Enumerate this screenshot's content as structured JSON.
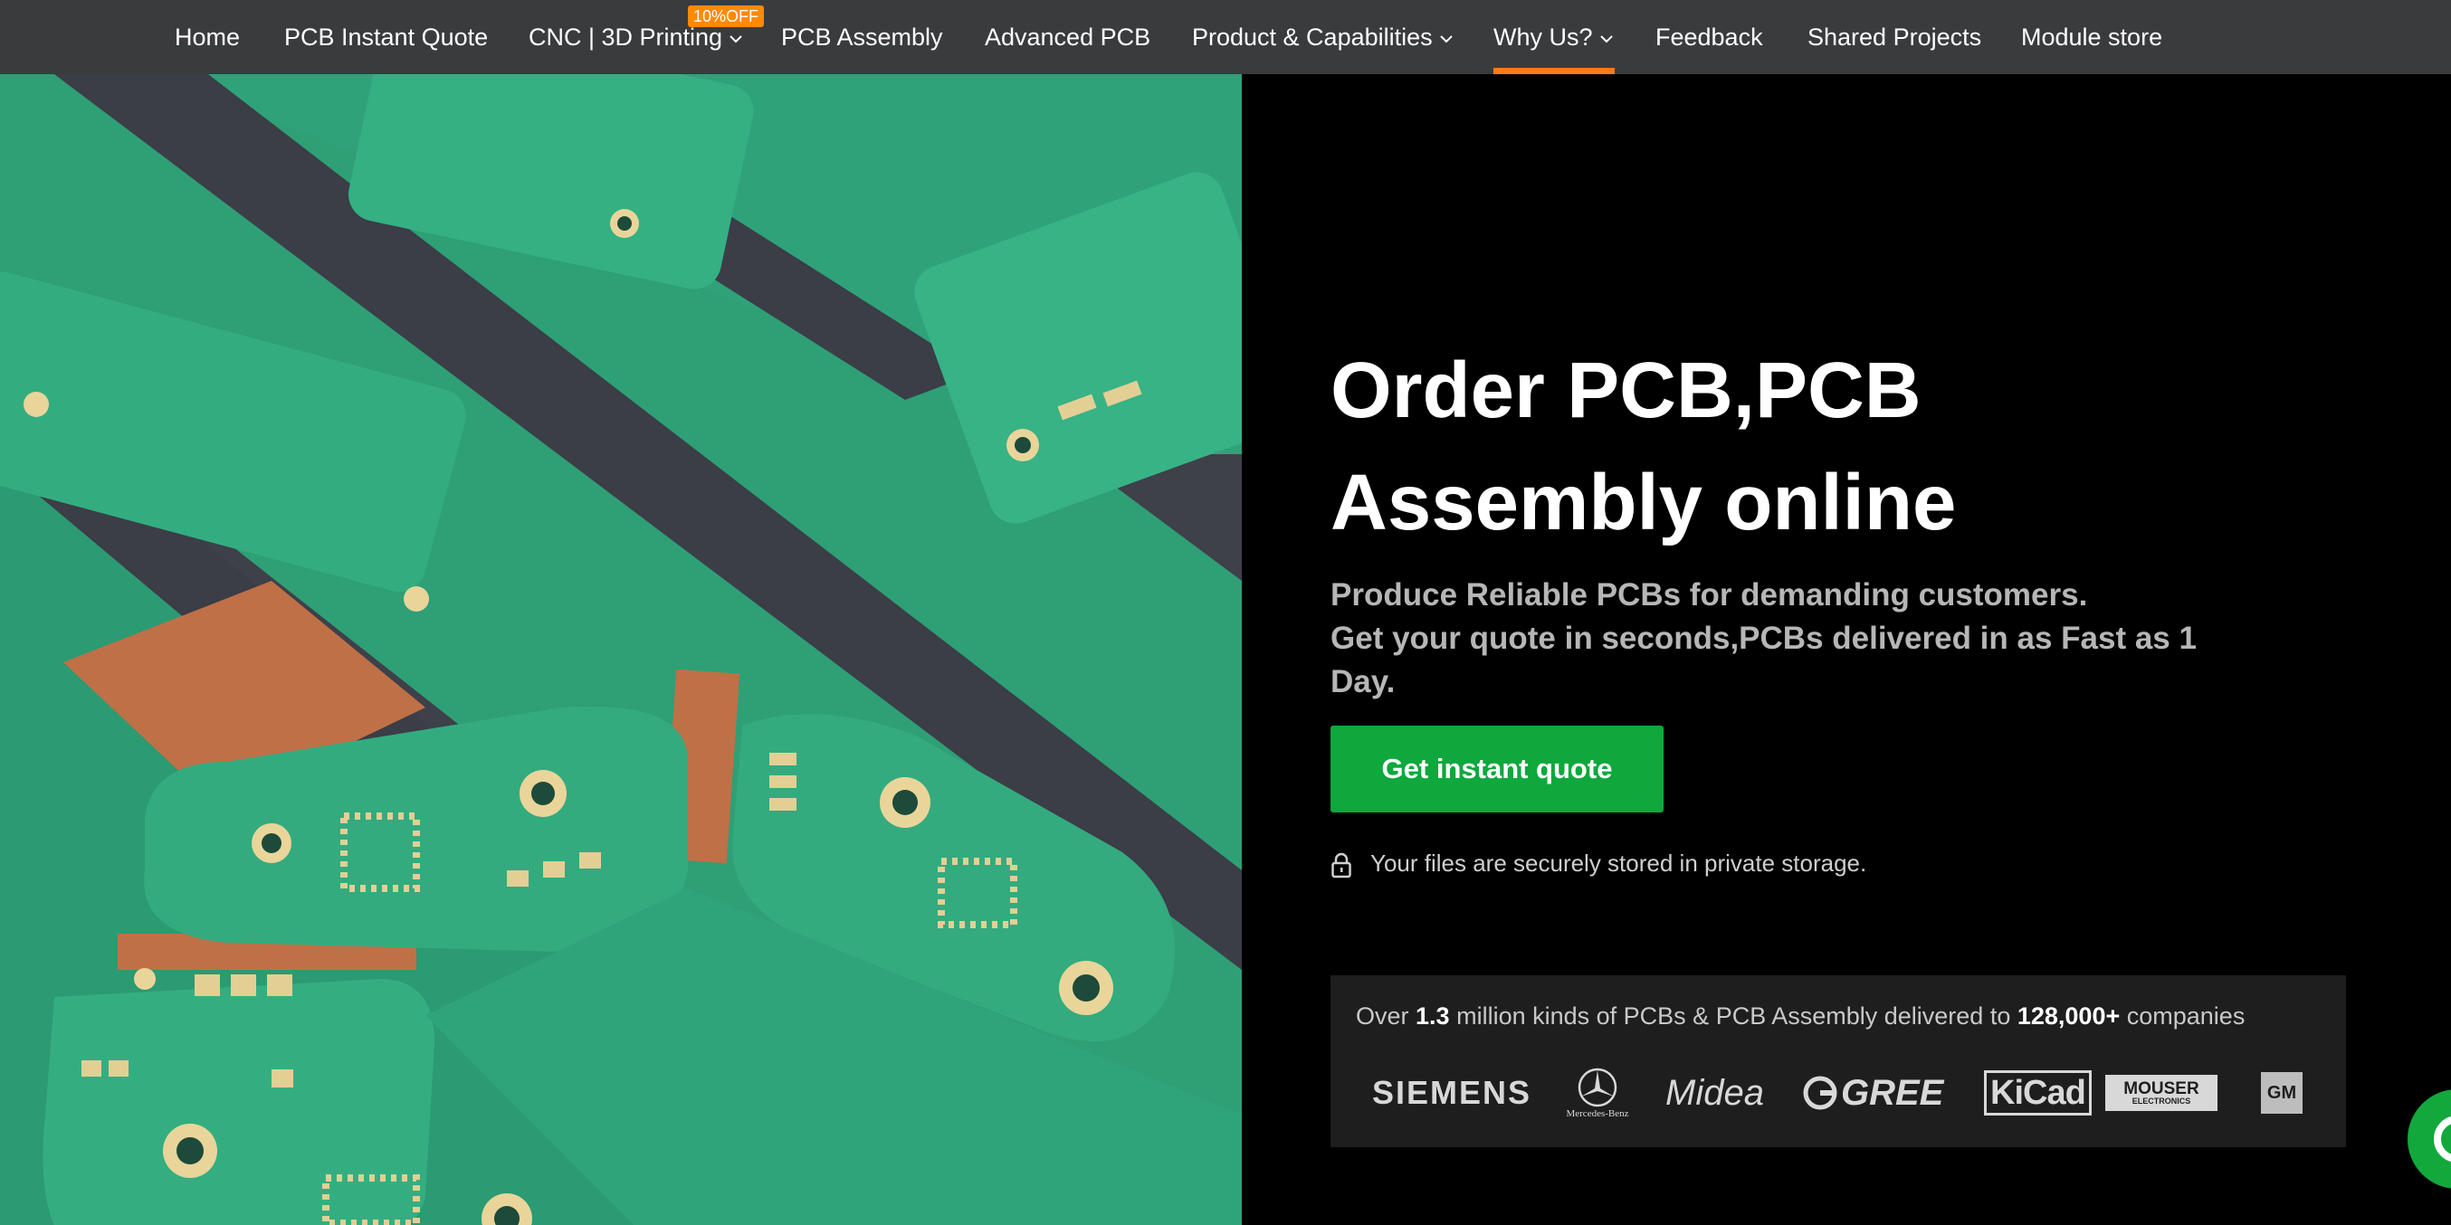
{
  "nav": {
    "items": [
      {
        "label": "Home"
      },
      {
        "label": "PCB Instant Quote"
      },
      {
        "label": "CNC | 3D Printing",
        "dropdown": true
      },
      {
        "label": "PCB Assembly"
      },
      {
        "label": "Advanced PCB"
      },
      {
        "label": "Product & Capabilities",
        "dropdown": true
      },
      {
        "label": "Why Us?",
        "dropdown": true,
        "active": true
      },
      {
        "label": "Feedback"
      },
      {
        "label": "Shared Projects"
      },
      {
        "label": "Module store"
      }
    ],
    "badge": "10%OFF",
    "active_color": "#ff7a1a",
    "badge_color": "#ff8a00"
  },
  "hero": {
    "headline_line1": "Order PCB,PCB",
    "headline_line2": "Assembly online",
    "sub_line1": "Produce Reliable PCBs for demanding customers.",
    "sub_line2": "Get your quote in seconds,PCBs delivered in as Fast as 1",
    "sub_line3": "Day.",
    "cta_label": "Get instant quote",
    "cta_color": "#0ea83c",
    "secure_text": "Your files are securely stored in private storage.",
    "secure_icon": "lock-icon"
  },
  "trust": {
    "prefix": "Over",
    "count1": "1.3",
    "middle": "million kinds of PCBs & PCB Assembly delivered to",
    "count2": "128,000+",
    "suffix": "companies",
    "logos": {
      "siemens": "SIEMENS",
      "mercedes": "Mercedes-Benz",
      "midea": "Midea",
      "gree": "GREE",
      "kicad": "KiCad",
      "mouser_line1": "MOUSER",
      "mouser_line2": "ELECTRONICS",
      "gm": "GM"
    }
  },
  "chat": {
    "icon": "chat-icon",
    "color": "#12a83c"
  }
}
